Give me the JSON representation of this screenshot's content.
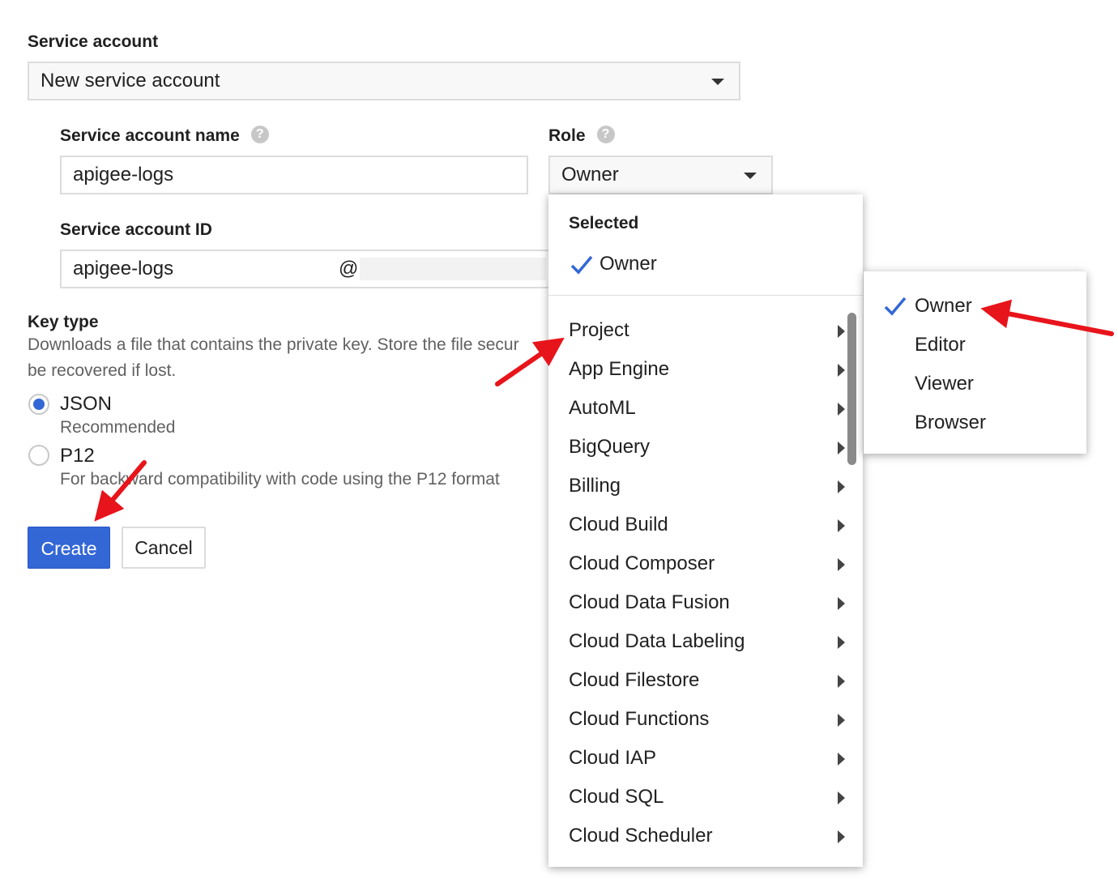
{
  "service_account": {
    "label": "Service account",
    "selected": "New service account"
  },
  "name_field": {
    "label": "Service account name",
    "value": "apigee-logs"
  },
  "role": {
    "label": "Role",
    "selected": "Owner"
  },
  "id_field": {
    "label": "Service account ID",
    "value": "apigee-logs",
    "suffix": "@"
  },
  "key_type": {
    "label": "Key type",
    "description_line1": "Downloads a file that contains the private key. Store the file secur",
    "description_line2": "be recovered if lost.",
    "options": [
      {
        "label": "JSON",
        "hint": "Recommended",
        "selected": true
      },
      {
        "label": "P12",
        "hint": "For backward compatibility with code using the P12 format",
        "selected": false
      }
    ]
  },
  "buttons": {
    "create": "Create",
    "cancel": "Cancel"
  },
  "role_menu": {
    "selected_header": "Selected",
    "selected_item": "Owner",
    "categories": [
      "Project",
      "App Engine",
      "AutoML",
      "BigQuery",
      "Billing",
      "Cloud Build",
      "Cloud Composer",
      "Cloud Data Fusion",
      "Cloud Data Labeling",
      "Cloud Filestore",
      "Cloud Functions",
      "Cloud IAP",
      "Cloud SQL",
      "Cloud Scheduler"
    ]
  },
  "project_submenu": {
    "items": [
      "Owner",
      "Editor",
      "Viewer",
      "Browser"
    ],
    "checked": "Owner"
  },
  "colors": {
    "primary_button": "#3367d6",
    "check": "#3367d6",
    "annotation_arrow": "#e8141b"
  },
  "icons": {
    "help": "question-circle-icon",
    "dropdown": "triangle-down-icon",
    "submenu": "triangle-right-icon",
    "check": "check-icon"
  }
}
